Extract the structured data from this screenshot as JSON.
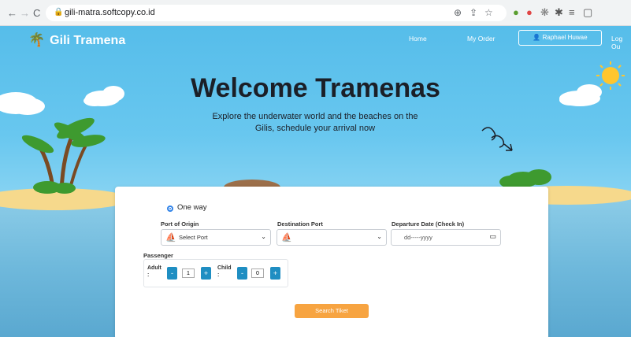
{
  "browser": {
    "url": "gili-matra.softcopy.co.id"
  },
  "header": {
    "brand": "Gili Tramena",
    "nav": [
      "Home",
      "My Order"
    ],
    "user": "Raphael Huwae",
    "logout": "Log Ou"
  },
  "hero": {
    "title": "Welcome Tramenas",
    "subtitle": "Explore the underwater world and the beaches on the Gilis, schedule your arrival now"
  },
  "form": {
    "trip_type": "One way",
    "origin_label": "Port of Origin",
    "origin_value": "Select Port",
    "destination_label": "Destination Port",
    "destination_value": "",
    "date_label": "Departure Date (Check In)",
    "date_placeholder": "dd-----yyyy",
    "passenger_label": "Passenger",
    "adult_label": "Adult",
    "adult_count": "1",
    "child_label": "Child",
    "child_count": "0",
    "minus": "-",
    "plus": "+",
    "colon": ":",
    "search_button": "Search Tiket"
  }
}
